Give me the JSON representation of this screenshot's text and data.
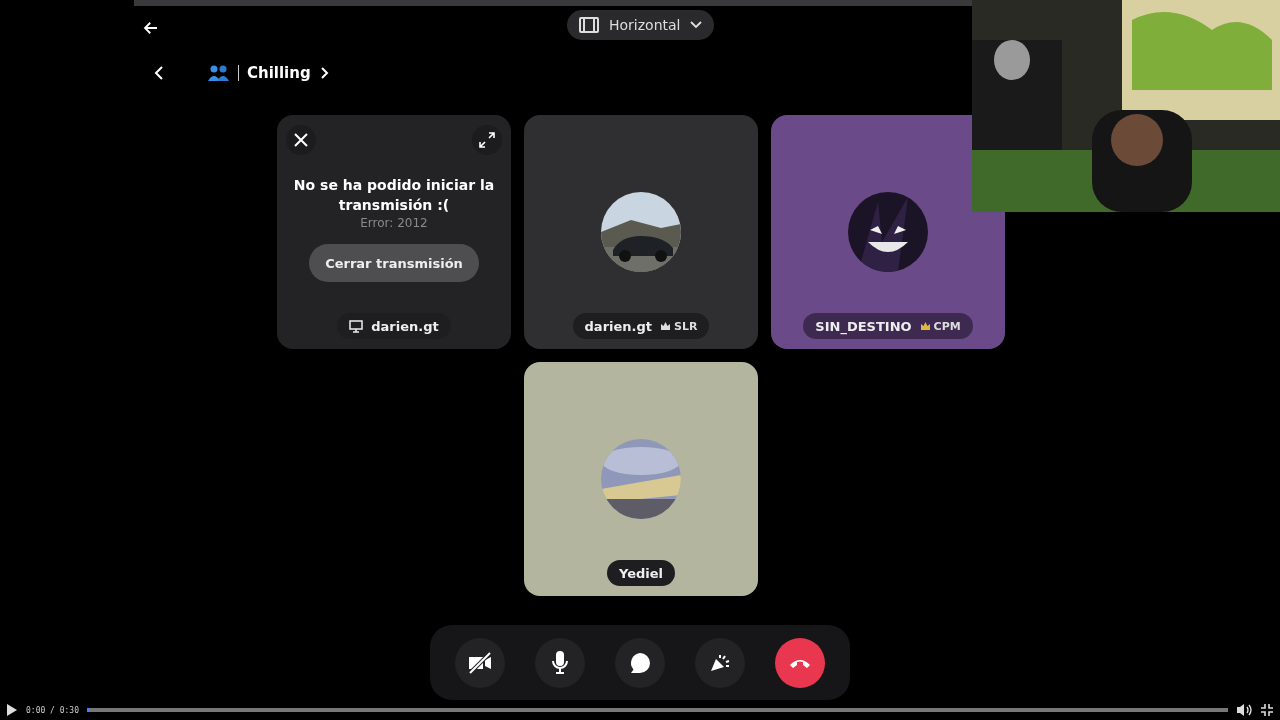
{
  "header": {
    "layout_menu": "Horizontal"
  },
  "channel": {
    "name": "Chilling"
  },
  "tiles": [
    {
      "kind": "stream_error",
      "message": "No se ha podido iniciar la transmisión :(",
      "error": "Error: 2012",
      "button": "Cerrar transmisión",
      "name": "darien.gt",
      "color": "#232325"
    },
    {
      "kind": "user",
      "name": "darien.gt",
      "tag": "SLR",
      "color": "#2f2f31"
    },
    {
      "kind": "user",
      "name": "SIN_DESTINO",
      "tag": "CPM",
      "color": "#6a4a88"
    },
    {
      "kind": "user",
      "name": "Yediel",
      "color": "#b3b59e"
    }
  ],
  "player": {
    "time": "0:00 / 0:30",
    "level": 0.003
  }
}
